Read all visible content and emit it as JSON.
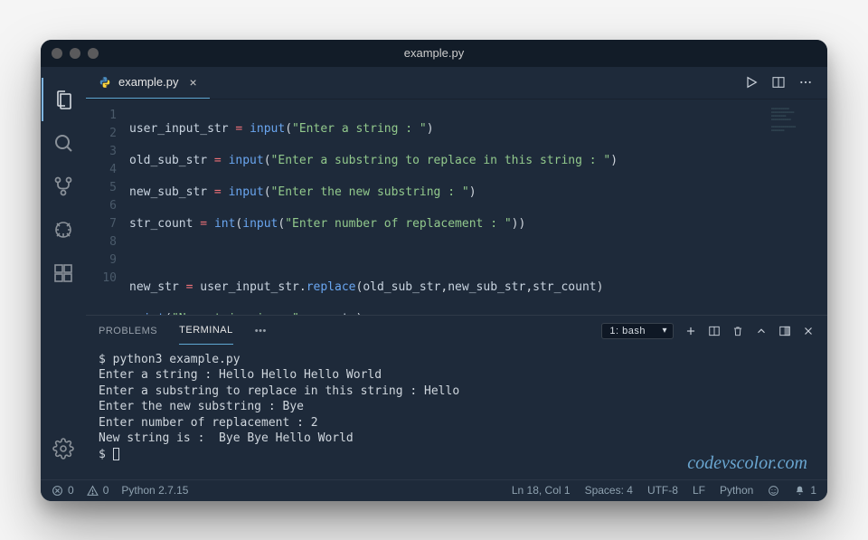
{
  "window": {
    "title": "example.py"
  },
  "tab": {
    "label": "example.py",
    "icon_name": "python-file-icon"
  },
  "editor_actions": {
    "run": "run-icon",
    "split": "split-editor-icon",
    "more": "more-icon"
  },
  "code_lines": {
    "l1_var": "user_input_str",
    "l1_fn": "input",
    "l1_str": "\"Enter a string : \"",
    "l2_var": "old_sub_str",
    "l2_fn": "input",
    "l2_str": "\"Enter a substring to replace in this string : \"",
    "l3_var": "new_sub_str",
    "l3_fn": "input",
    "l3_str": "\"Enter the new substring : \"",
    "l4_var": "str_count",
    "l4_fn1": "int",
    "l4_fn2": "input",
    "l4_str": "\"Enter number of replacement : \"",
    "l6_var": "new_str",
    "l6_rhs1": "user_input_str",
    "l6_method": "replace",
    "l6_arg1": "old_sub_str",
    "l6_arg2": "new_sub_str",
    "l6_arg3": "str_count",
    "l7_fn": "print",
    "l7_str": "\"New string is : \"",
    "l7_arg": "new_str"
  },
  "line_numbers": [
    "1",
    "2",
    "3",
    "4",
    "5",
    "6",
    "7",
    "8",
    "9",
    "10"
  ],
  "panel": {
    "tab_problems": "PROBLEMS",
    "tab_terminal": "TERMINAL",
    "dropdown_label": "1: bash"
  },
  "terminal": {
    "l1": "$ python3 example.py",
    "l2": "Enter a string : Hello Hello Hello World",
    "l3": "Enter a substring to replace in this string : Hello",
    "l4": "Enter the new substring : Bye",
    "l5": "Enter number of replacement : 2",
    "l6": "New string is :  Bye Bye Hello World",
    "l7_prompt": "$ "
  },
  "status": {
    "errors": "0",
    "warnings": "0",
    "python_version": "Python 2.7.15",
    "position": "Ln 18, Col 1",
    "spaces": "Spaces: 4",
    "encoding": "UTF-8",
    "eol": "LF",
    "language": "Python",
    "bell": "1"
  },
  "watermark": "codevscolor.com"
}
